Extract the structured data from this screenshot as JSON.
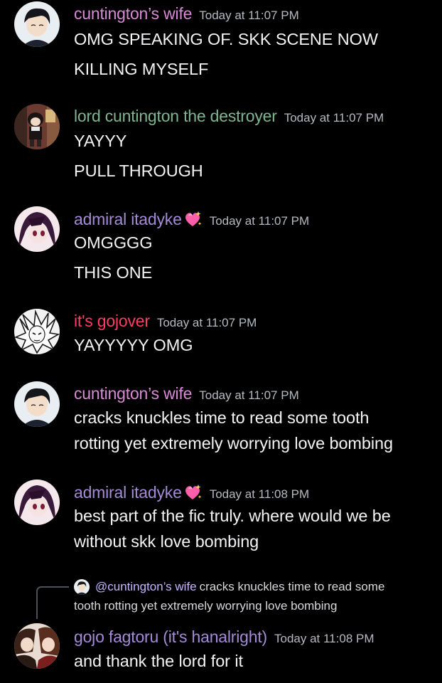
{
  "colors": {
    "background": "#000000",
    "name_wife": "#d98ad6",
    "name_lord": "#7fb58f",
    "name_admiral": "#a58ad6",
    "name_gojover": "#ff3d64",
    "name_gojo": "#a58ad6",
    "timestamp": "#b5bac1",
    "text": "#f2f3f5"
  },
  "messages": [
    {
      "username": "cuntington’s wife",
      "timestamp": "Today at 11:07 PM",
      "lines": [
        "OMG SPEAKING OF. SKK SCENE NOW",
        "KILLING MYSELF"
      ],
      "avatar": "avatar-dark-hair-boy",
      "name_color": "#d98ad6"
    },
    {
      "username": "lord cuntington the destroyer",
      "timestamp": "Today at 11:07 PM",
      "lines": [
        "YAYYY",
        "PULL THROUGH"
      ],
      "avatar": "avatar-chibi-room",
      "name_color": "#7fb58f"
    },
    {
      "username": "admiral itadyke",
      "emoji": "sparkling-heart-icon",
      "timestamp": "Today at 11:07 PM",
      "lines": [
        "OMGGGG",
        "THIS ONE"
      ],
      "avatar": "avatar-purple-girl",
      "name_color": "#a58ad6"
    },
    {
      "username": "it's gojover",
      "timestamp": "Today at 11:07 PM",
      "lines": [
        "YAYYYYY OMG"
      ],
      "avatar": "avatar-manga-sketch",
      "name_color": "#ff3d64"
    },
    {
      "username": "cuntington’s wife",
      "timestamp": "Today at 11:07 PM",
      "lines": [
        "cracks knuckles time to read some tooth",
        "rotting yet extremely worrying love bombing"
      ],
      "avatar": "avatar-dark-hair-boy",
      "name_color": "#d98ad6"
    },
    {
      "username": "admiral itadyke",
      "emoji": "sparkling-heart-icon",
      "timestamp": "Today at 11:08 PM",
      "lines": [
        "best part of the fic truly. where would we be",
        "without skk love bombing"
      ],
      "avatar": "avatar-purple-girl",
      "name_color": "#a58ad6"
    },
    {
      "username": "gojo fagtoru (it's hanalright)",
      "timestamp": "Today at 11:08 PM",
      "lines": [
        "and thank the lord for it"
      ],
      "avatar": "avatar-brown-hair-pair",
      "name_color": "#a58ad6",
      "reply": {
        "mention": "@cuntington’s wife",
        "text_line1": "cracks knuckles time to read some",
        "text_line2": "tooth rotting yet extremely worrying love bombing"
      }
    }
  ]
}
